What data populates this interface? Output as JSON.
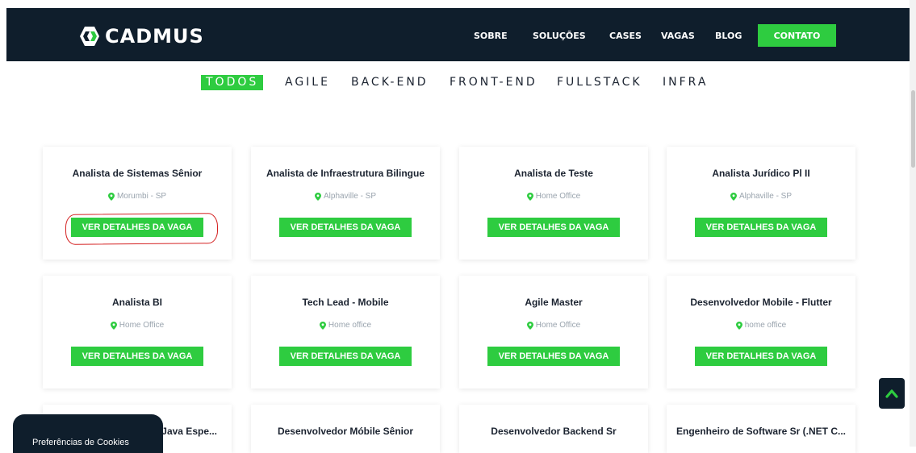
{
  "brand": {
    "name": "CADMUS"
  },
  "nav": {
    "items": [
      "SOBRE",
      "SOLUÇÕES",
      "CASES",
      "VAGAS",
      "BLOG"
    ],
    "cta": "CONTATO"
  },
  "filters": [
    "TODOS",
    "AGILE",
    "BACK-END",
    "FRONT-END",
    "FULLSTACK",
    "INFRA"
  ],
  "active_filter": "TODOS",
  "jobs": [
    {
      "title": "Analista de Sistemas Sênior",
      "location": "Morumbi - SP",
      "button": "VER DETALHES DA VAGA"
    },
    {
      "title": "Analista de Infraestrutura Bilingue",
      "location": "Alphaville - SP",
      "button": "VER DETALHES DA VAGA"
    },
    {
      "title": "Analista de Teste",
      "location": "Home Office",
      "button": "VER DETALHES DA VAGA"
    },
    {
      "title": "Analista Jurídico Pl II",
      "location": "Alphaville - SP",
      "button": "VER DETALHES DA VAGA"
    },
    {
      "title": "Analista BI",
      "location": "Home Office",
      "button": "VER DETALHES DA VAGA"
    },
    {
      "title": "Tech Lead - Mobile",
      "location": "Home office",
      "button": "VER DETALHES DA VAGA"
    },
    {
      "title": "Agile Master",
      "location": "Home Office",
      "button": "VER DETALHES DA VAGA"
    },
    {
      "title": "Desenvolvedor Mobile - Flutter",
      "location": "home office",
      "button": "VER DETALHES DA VAGA"
    },
    {
      "title": "Java Espe...",
      "location": "",
      "button": ""
    },
    {
      "title": "Desenvolvedor Móbile Sênior",
      "location": "",
      "button": ""
    },
    {
      "title": "Desenvolvedor Backend Sr",
      "location": "",
      "button": ""
    },
    {
      "title": "Engenheiro de Software Sr (.NET C...",
      "location": "",
      "button": ""
    }
  ],
  "cookie": {
    "label": "Preferências de Cookies"
  },
  "icons": {
    "location": "map-pin-icon",
    "scroll_top": "chevron-up-icon"
  },
  "colors": {
    "navy": "#0f1e2c",
    "accent": "#2ecc40",
    "highlight": "#d42020"
  }
}
